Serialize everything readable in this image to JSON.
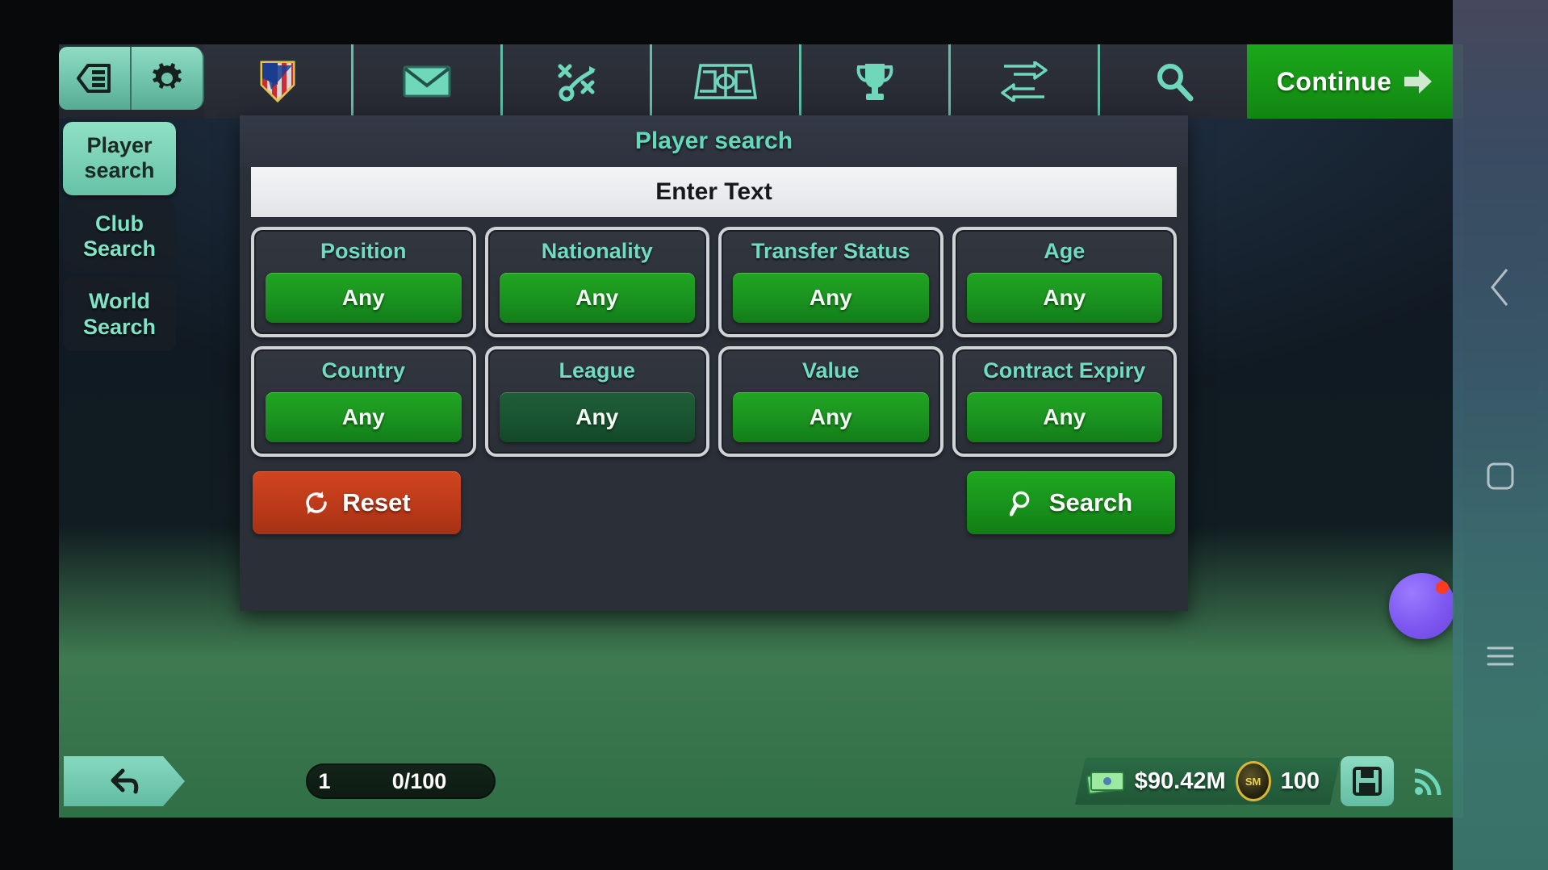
{
  "toolbar": {
    "left_buttons": [
      {
        "name": "menu",
        "icon": "list-menu-icon"
      },
      {
        "name": "settings",
        "icon": "gear-icon"
      }
    ],
    "tabs": [
      {
        "name": "club",
        "icon": "club-crest-icon"
      },
      {
        "name": "inbox",
        "icon": "envelope-icon"
      },
      {
        "name": "tactics",
        "icon": "tactics-icon"
      },
      {
        "name": "pitch",
        "icon": "pitch-icon"
      },
      {
        "name": "competitions",
        "icon": "trophy-icon"
      },
      {
        "name": "transfers",
        "icon": "transfer-arrows-icon"
      },
      {
        "name": "search",
        "icon": "magnifier-icon"
      }
    ],
    "continue_label": "Continue",
    "continue_icon": "arrow-right-icon",
    "continue_color": "#169416"
  },
  "rail": {
    "items": [
      {
        "label": "Player search",
        "active": true
      },
      {
        "label": "Club Search",
        "active": false
      },
      {
        "label": "World Search",
        "active": false
      }
    ]
  },
  "panel": {
    "title": "Player search",
    "search_input": {
      "value": "",
      "placeholder": "Enter Text"
    },
    "filters": [
      {
        "label": "Position",
        "value": "Any",
        "dim": false
      },
      {
        "label": "Nationality",
        "value": "Any",
        "dim": false
      },
      {
        "label": "Transfer Status",
        "value": "Any",
        "dim": false
      },
      {
        "label": "Age",
        "value": "Any",
        "dim": false
      },
      {
        "label": "Country",
        "value": "Any",
        "dim": false
      },
      {
        "label": "League",
        "value": "Any",
        "dim": true
      },
      {
        "label": "Value",
        "value": "Any",
        "dim": false
      },
      {
        "label": "Contract Expiry",
        "value": "Any",
        "dim": false
      }
    ],
    "reset_label": "Reset",
    "reset_icon": "refresh-icon",
    "reset_color": "#bc3a19",
    "search_label": "Search",
    "search_icon": "magnifier-icon",
    "search_color": "#18921c"
  },
  "bottom": {
    "back_icon": "back-arrow-icon",
    "progress_page": "1",
    "progress_count": "0/100",
    "money_icon": "cash-stack-icon",
    "money": "$90.42M",
    "token_icon": "coin-icon",
    "tokens": "100",
    "save_icon": "save-disk-icon",
    "feed_icon": "rss-icon"
  },
  "android_nav": {
    "back_icon": "chevron-left-icon",
    "home_icon": "square-home-icon",
    "recents_icon": "recents-lines-icon"
  },
  "overlay": {
    "bubble_icon": "floating-bubble-icon",
    "badge_color": "#ff3b1f"
  },
  "colors": {
    "accent_teal": "#6fdcc0",
    "panel_bg": "#2b2f38",
    "green": "#1a9220",
    "red": "#bc3a19"
  }
}
